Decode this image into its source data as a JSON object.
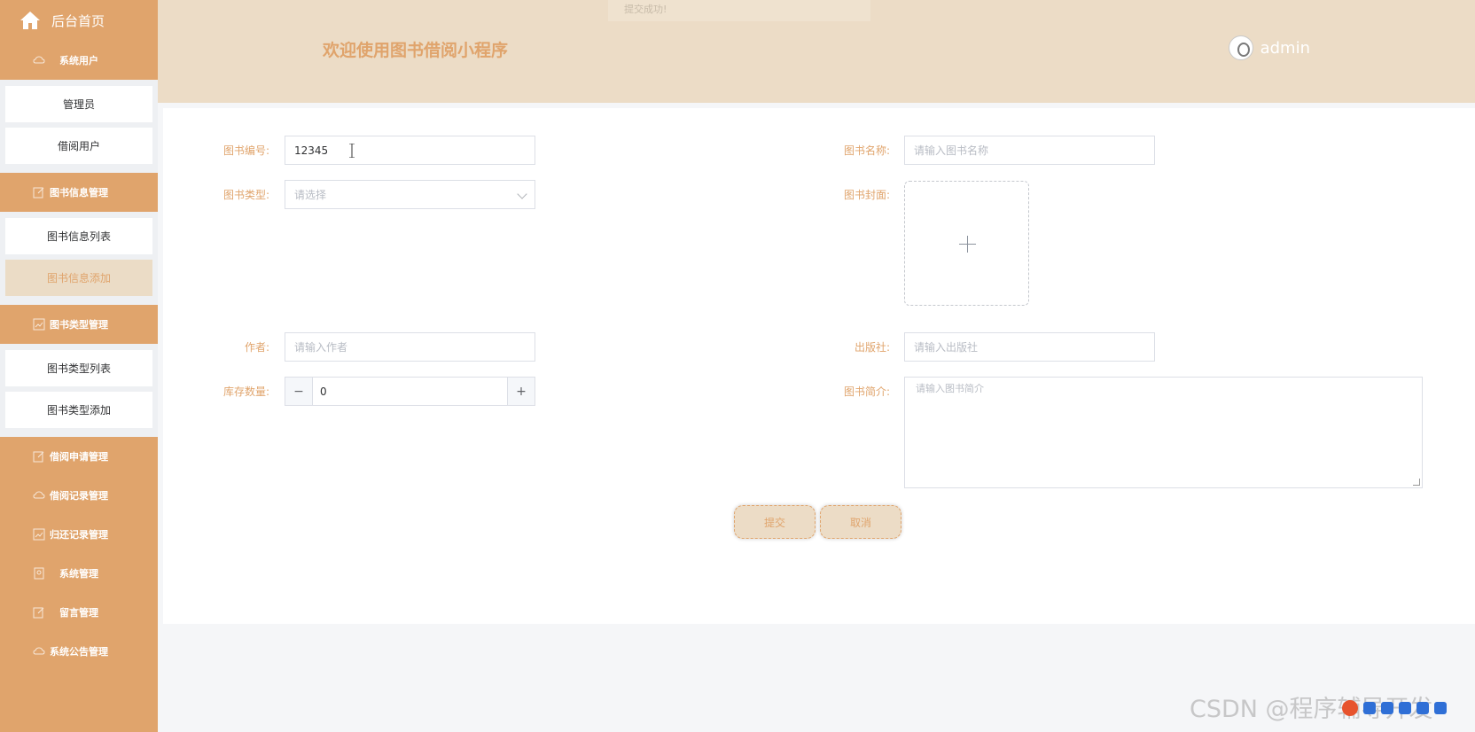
{
  "sidebar": {
    "home_label": "后台首页",
    "groups": [
      {
        "label": "系统用户",
        "icon": "cloud-icon",
        "items": [
          "管理员",
          "借阅用户"
        ]
      },
      {
        "label": "图书信息管理",
        "icon": "edit-icon",
        "items": [
          "图书信息列表",
          "图书信息添加"
        ],
        "active_item": "图书信息添加"
      },
      {
        "label": "图书类型管理",
        "icon": "chart-icon",
        "items": [
          "图书类型列表",
          "图书类型添加"
        ]
      },
      {
        "label": "借阅申请管理",
        "icon": "edit-icon",
        "items": []
      },
      {
        "label": "借阅记录管理",
        "icon": "cloud-icon",
        "items": []
      },
      {
        "label": "归还记录管理",
        "icon": "chart-icon",
        "items": []
      },
      {
        "label": "系统管理",
        "icon": "bookmark-icon",
        "items": []
      },
      {
        "label": "留言管理",
        "icon": "edit-icon",
        "items": []
      },
      {
        "label": "系统公告管理",
        "icon": "cloud-icon",
        "items": []
      }
    ]
  },
  "header": {
    "title": "欢迎使用图书借阅小程序",
    "username": "admin",
    "toast": "提交成功!"
  },
  "form": {
    "book_no": {
      "label": "图书编号:",
      "value": "12345"
    },
    "book_name": {
      "label": "图书名称:",
      "placeholder": "请输入图书名称"
    },
    "book_type": {
      "label": "图书类型:",
      "placeholder": "请选择"
    },
    "cover": {
      "label": "图书封面:"
    },
    "author": {
      "label": "作者:",
      "placeholder": "请输入作者"
    },
    "publisher": {
      "label": "出版社:",
      "placeholder": "请输入出版社"
    },
    "stock": {
      "label": "库存数量:",
      "value": "0",
      "minus": "−",
      "plus": "+"
    },
    "intro": {
      "label": "图书简介:",
      "placeholder": "请输入图书简介"
    },
    "submit_label": "提交",
    "cancel_label": "取消"
  },
  "watermark": "CSDN @程序辅导开发",
  "colors": {
    "accent": "#e0a46c",
    "header_bg": "#ecdcc6",
    "active_bg": "#ebdcc6"
  }
}
